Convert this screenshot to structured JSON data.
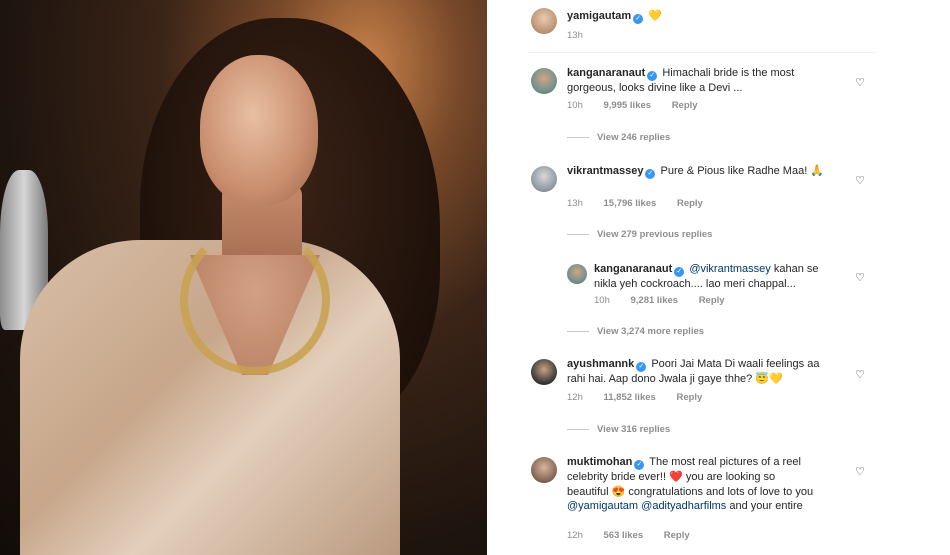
{
  "post": {
    "username": "yamigautam",
    "caption_emoji": "💛",
    "time": "13h"
  },
  "comments": [
    {
      "username": "kanganaranaut",
      "text": "Himachali bride is the most gorgeous, looks divine like a Devi ...",
      "time": "10h",
      "likes": "9,995 likes",
      "reply": "Reply",
      "view_replies": "View 246 replies"
    },
    {
      "username": "vikrantmassey",
      "text": "Pure & Pious like Radhe Maa! 🙏",
      "time": "13h",
      "likes": "15,796 likes",
      "reply": "Reply",
      "view_replies": "View 279 previous replies"
    },
    {
      "username": "kanganaranaut",
      "mention": "@vikrantmassey",
      "text": "kahan se nikla yeh cockroach.... lao meri chappal...",
      "time": "10h",
      "likes": "9,281 likes",
      "reply": "Reply",
      "view_replies": "View 3,274 more replies"
    },
    {
      "username": "ayushmannk",
      "text": "Poori Jai Mata Di waali feelings aa rahi hai. Aap dono Jwala ji gaye thhe? 😇💛",
      "time": "12h",
      "likes": "11,852 likes",
      "reply": "Reply",
      "view_replies": "View 316 replies"
    },
    {
      "username": "muktimohan",
      "text_a": "The most real pictures of a reel celebrity bride ever!! ❤️ you are looking so beautiful 😍 congratulations and lots of love to you",
      "mention_a": "@yamigautam",
      "mention_b": "@adityadharfilms",
      "text_b": "and your entire",
      "time": "12h",
      "likes": "563 likes",
      "reply": "Reply"
    }
  ],
  "icons": {
    "verified": "✓",
    "heart": "♡"
  },
  "colors": {
    "verified": "#3897f0",
    "mention": "#00376b",
    "meta": "#8e8e8e"
  }
}
